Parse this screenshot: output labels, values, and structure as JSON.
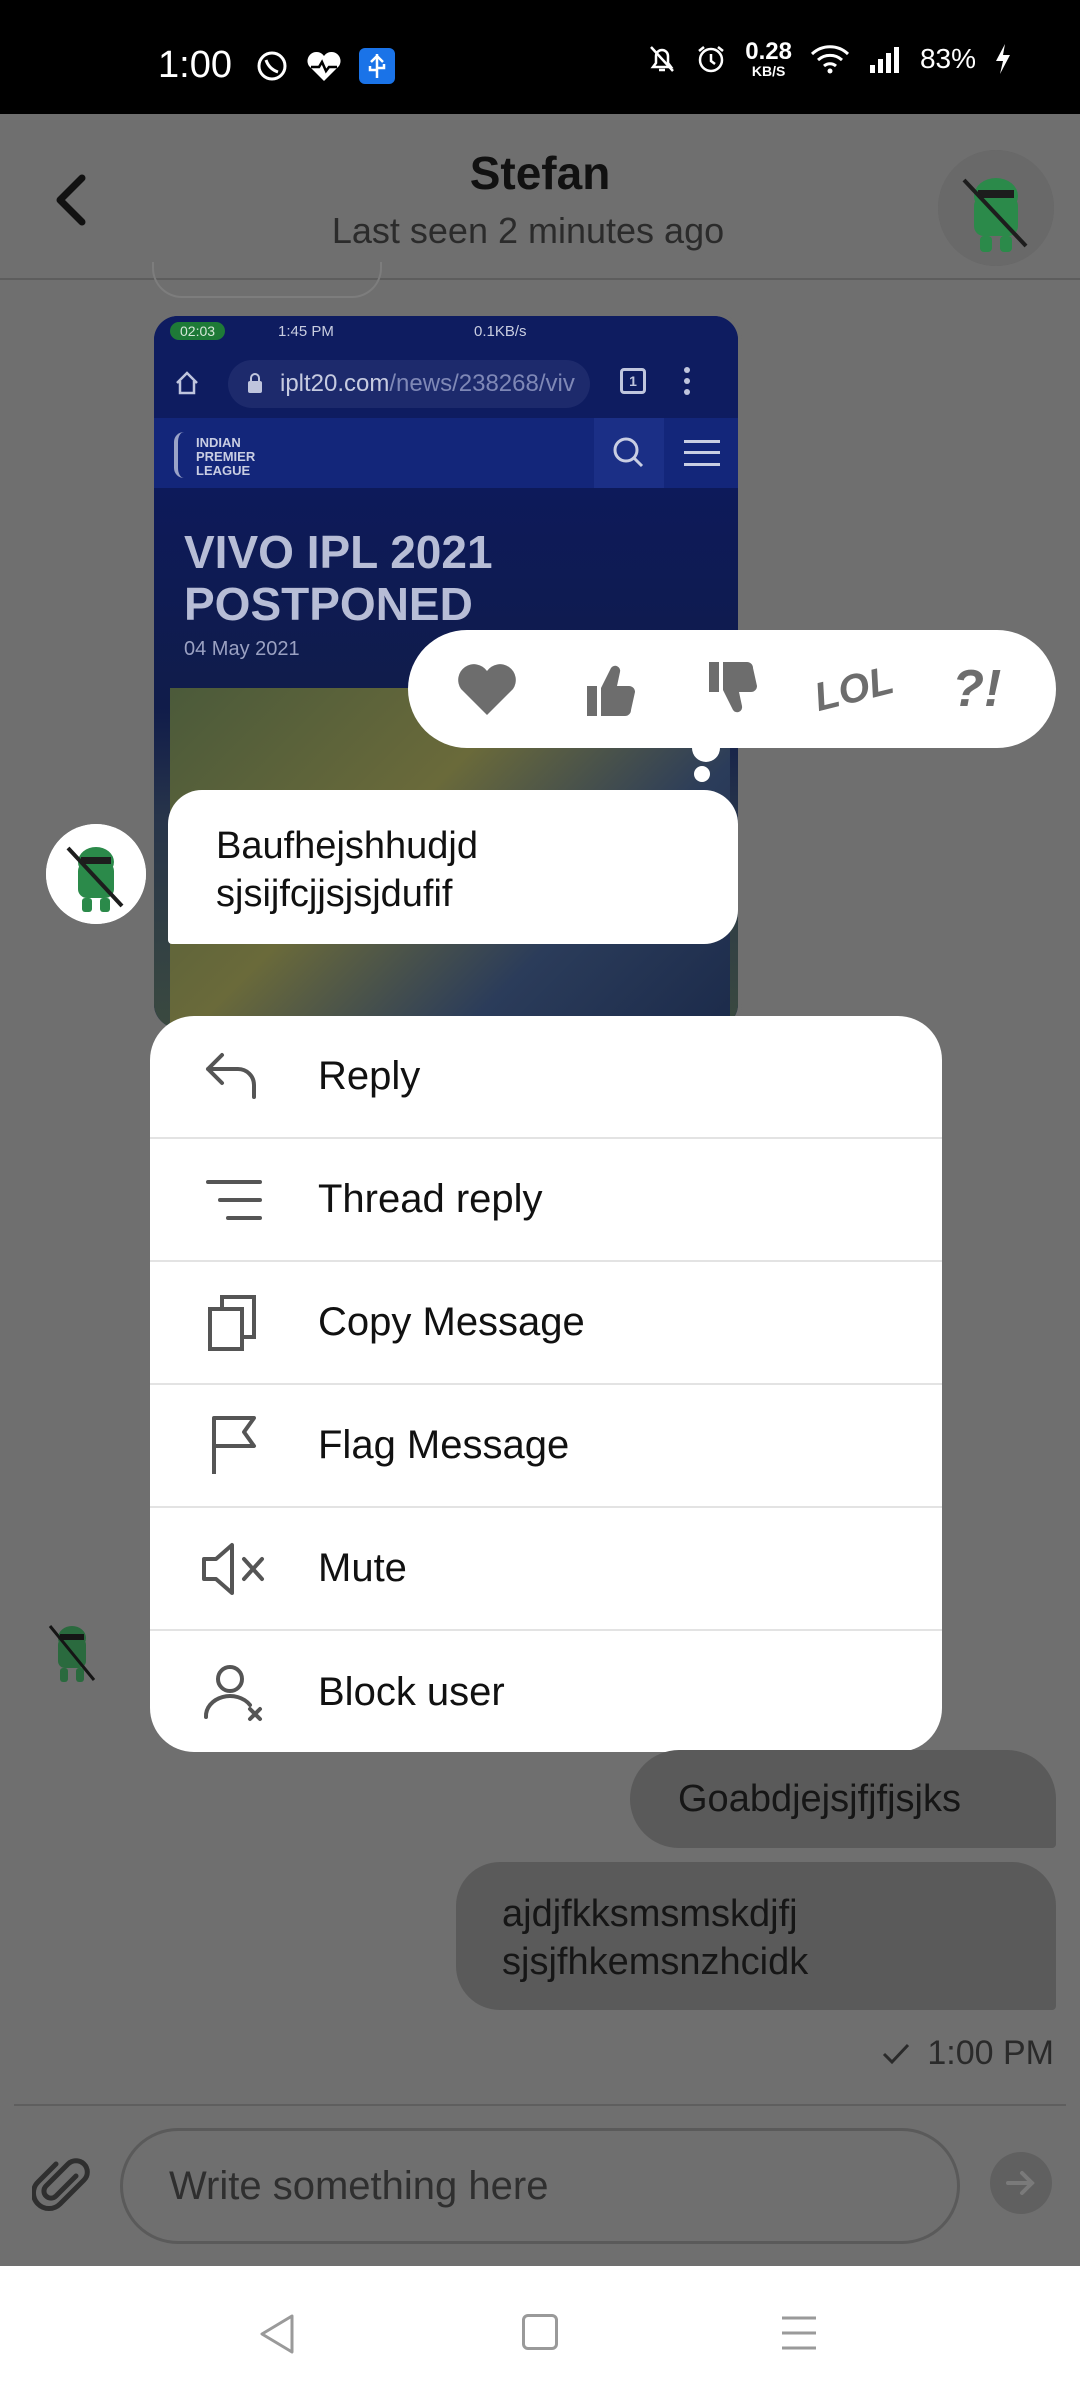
{
  "status_bar": {
    "time": "1:00",
    "net_speed_value": "0.28",
    "net_speed_unit": "KB/S",
    "battery": "83%"
  },
  "header": {
    "contact_name": "Stefan",
    "last_seen": "Last seen 2 minutes ago"
  },
  "shared_screenshot": {
    "call_badge": "02:03",
    "time": "1:45 PM",
    "rate": "0.1KB/s",
    "url_domain": "iplt20.com",
    "url_path": "/news/238268/viv",
    "tab_count": "1",
    "logo_text": "INDIAN PREMIER LEAGUE",
    "headline": "VIVO IPL 2021 POSTPONED",
    "date": "04 May 2021"
  },
  "reactions": [
    {
      "name": "heart-icon"
    },
    {
      "name": "thumbs-up-icon"
    },
    {
      "name": "thumbs-down-icon"
    },
    {
      "name": "lol-reaction",
      "label": "LOL"
    },
    {
      "name": "wow-reaction",
      "label": "?!"
    }
  ],
  "selected_message": {
    "line1": "Baufhejshhudjd",
    "line2": "sjsijfcjjsjsjdufif"
  },
  "context_menu": {
    "items": [
      {
        "label": "Reply",
        "icon": "reply-icon"
      },
      {
        "label": "Thread reply",
        "icon": "thread-reply-icon"
      },
      {
        "label": "Copy Message",
        "icon": "copy-icon"
      },
      {
        "label": "Flag Message",
        "icon": "flag-icon"
      },
      {
        "label": "Mute",
        "icon": "mute-icon"
      },
      {
        "label": "Block user",
        "icon": "block-user-icon"
      }
    ]
  },
  "outgoing": {
    "msg1": "Goabdjejsjfjfjsjks",
    "msg2_line1": "ajdjfkksmsmskdjfj",
    "msg2_line2": "sjsjfhkemsnzhcidk",
    "timestamp": "1:00 PM"
  },
  "composer": {
    "placeholder": "Write something here"
  }
}
